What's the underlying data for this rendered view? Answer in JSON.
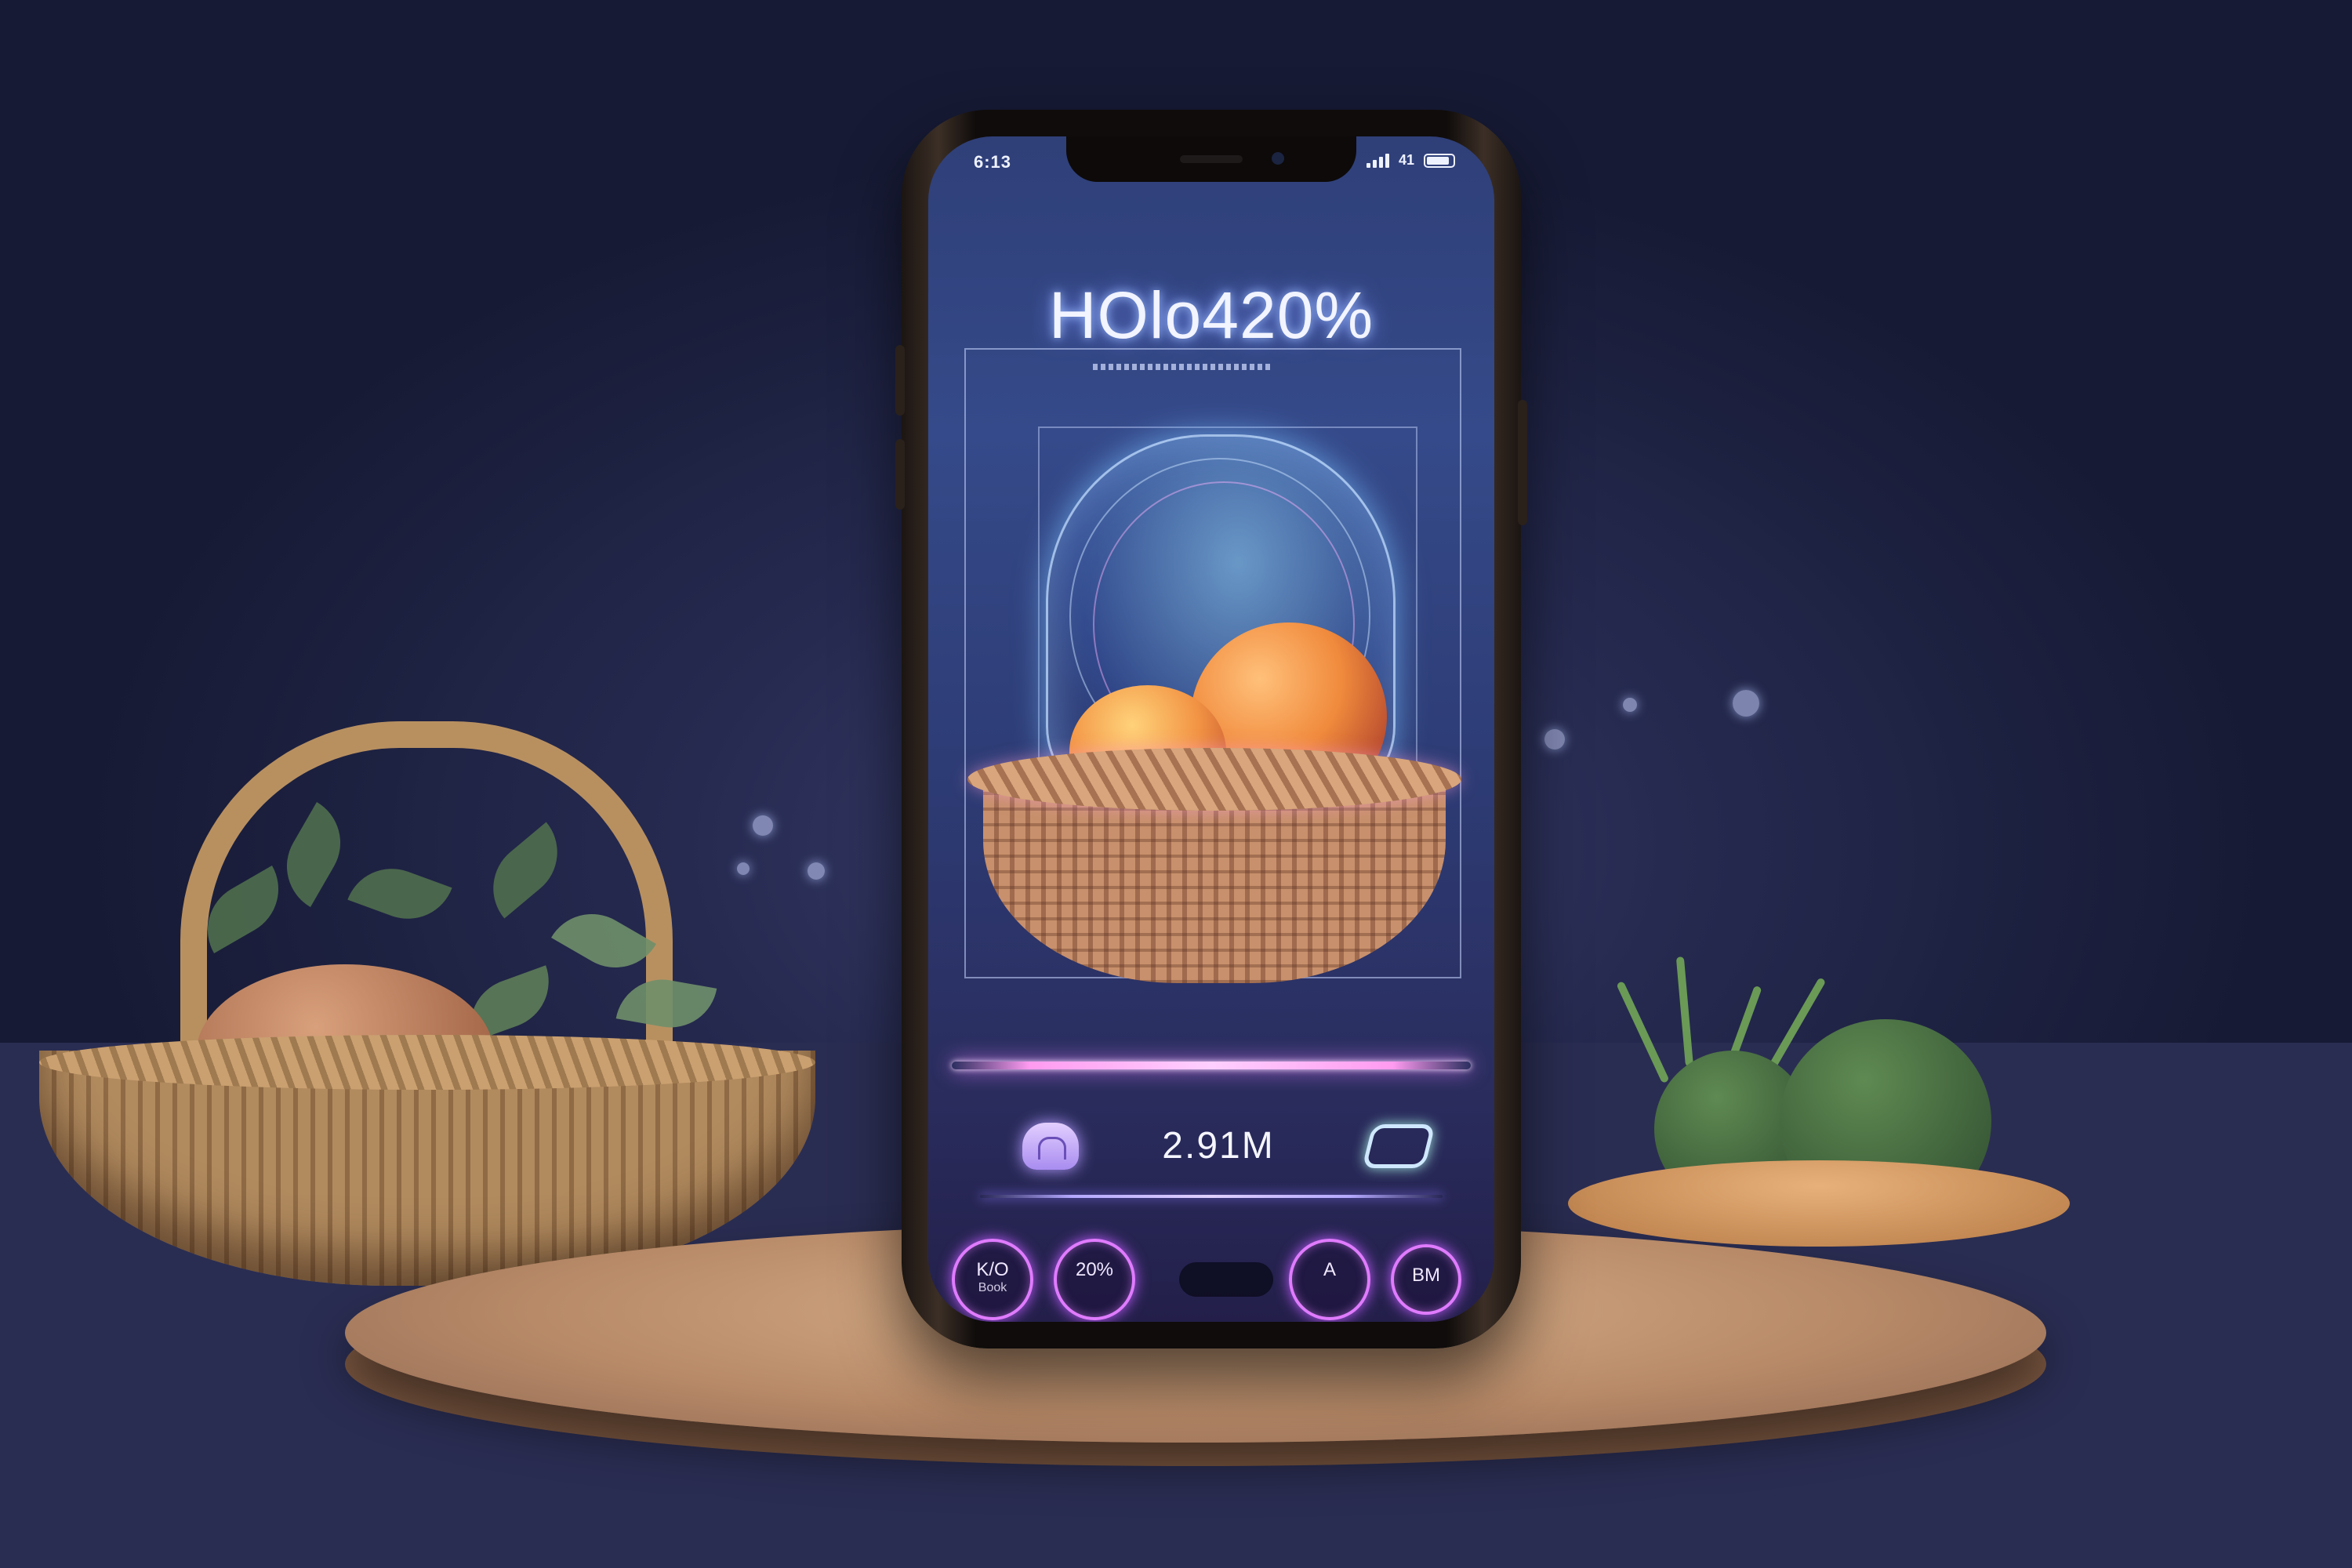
{
  "status_bar": {
    "time": "6:13",
    "carrier": "41"
  },
  "app": {
    "headline": "HOlo420%",
    "info_value": "2.91M",
    "nav_buttons": [
      {
        "line1": "K/O",
        "line2": "Book"
      },
      {
        "line1": "20%",
        "line2": ""
      },
      {
        "line1": "A",
        "line2": ""
      },
      {
        "line1": "BM",
        "line2": ""
      }
    ]
  },
  "colors": {
    "accent_glow": "#e07bff",
    "hologram_blue": "#9ec0ff",
    "screen_bg": "#2f3f78"
  },
  "icons": {
    "tag": "tag-icon",
    "link": "link-icon",
    "signal": "signal-icon",
    "battery": "battery-icon"
  }
}
